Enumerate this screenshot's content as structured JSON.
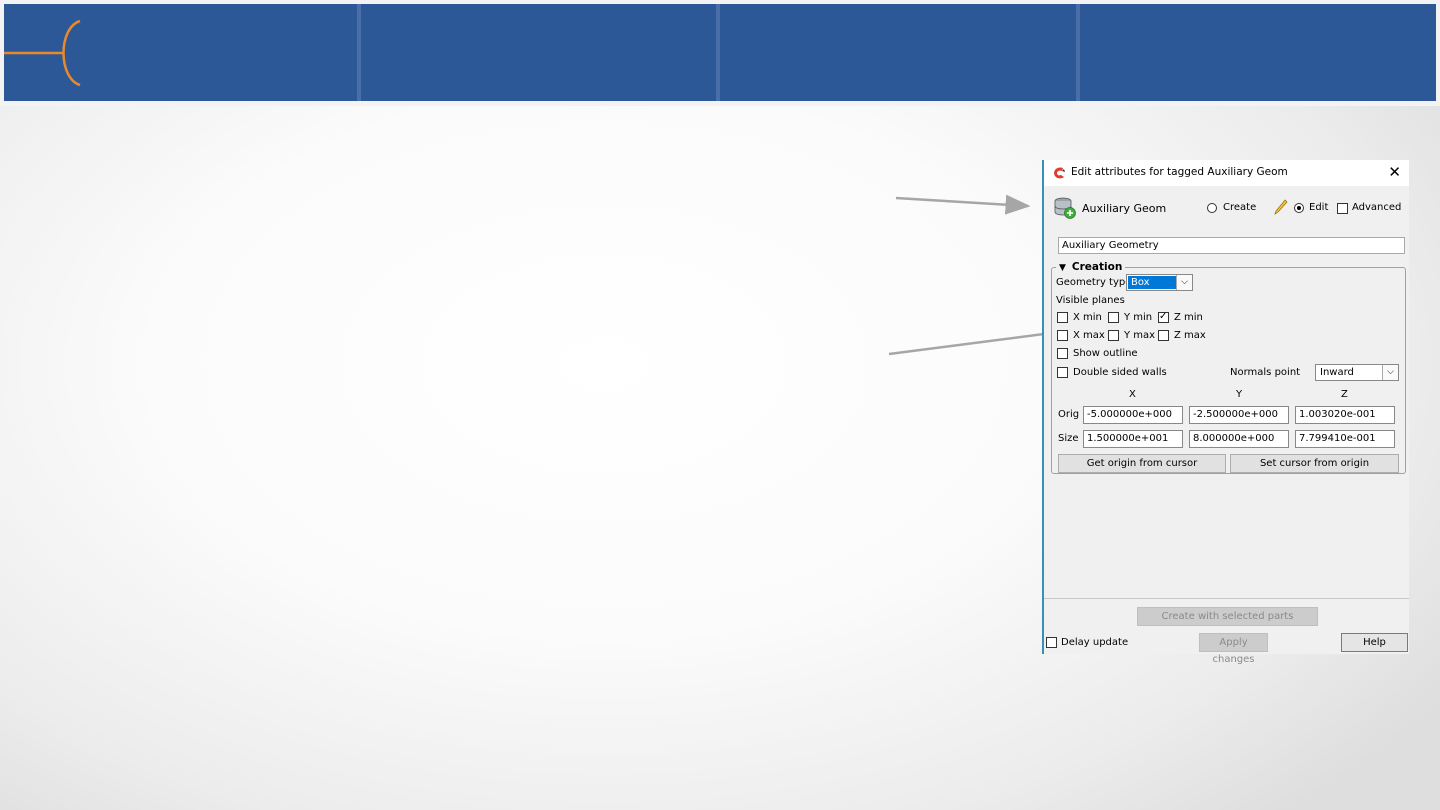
{
  "dialog": {
    "title": "Edit attributes for tagged Auxiliary Geom",
    "object_label": "Auxiliary Geom",
    "mode_create": "Create",
    "mode_edit": "Edit",
    "advanced": "Advanced",
    "name_value": "Auxiliary Geometry",
    "section_title": "Creation",
    "geometry_type_label": "Geometry type",
    "geometry_type_value": "Box",
    "visible_planes_label": "Visible planes",
    "planes": {
      "xmin": "X min",
      "ymin": "Y min",
      "zmin": "Z min",
      "xmax": "X max",
      "ymax": "Y max",
      "zmax": "Z max"
    },
    "show_outline": "Show outline",
    "double_sided": "Double sided walls",
    "normals_label": "Normals point",
    "normals_value": "Inward",
    "col_x": "X",
    "col_y": "Y",
    "col_z": "Z",
    "orig_label": "Orig",
    "size_label": "Size",
    "orig": [
      "-5.000000e+000",
      "-2.500000e+000",
      "1.003020e-001"
    ],
    "size": [
      "1.500000e+001",
      "8.000000e+000",
      "7.799410e-001"
    ],
    "get_origin_btn": "Get origin from cursor",
    "set_cursor_btn": "Set cursor from origin",
    "create_selected_btn": "Create with selected parts",
    "delay_update": "Delay update",
    "apply_btn": "Apply changes",
    "help_btn": "Help",
    "checked": {
      "zmin": true,
      "edit": true
    }
  },
  "colors": {
    "banner": "#2d5897",
    "accent_orange": "#e8892b",
    "selection": "#0078d7"
  },
  "icons": [
    "app-logo-icon",
    "close-icon",
    "database-add-icon",
    "pencil-icon",
    "triangle-down-icon",
    "chevron-down-icon"
  ]
}
